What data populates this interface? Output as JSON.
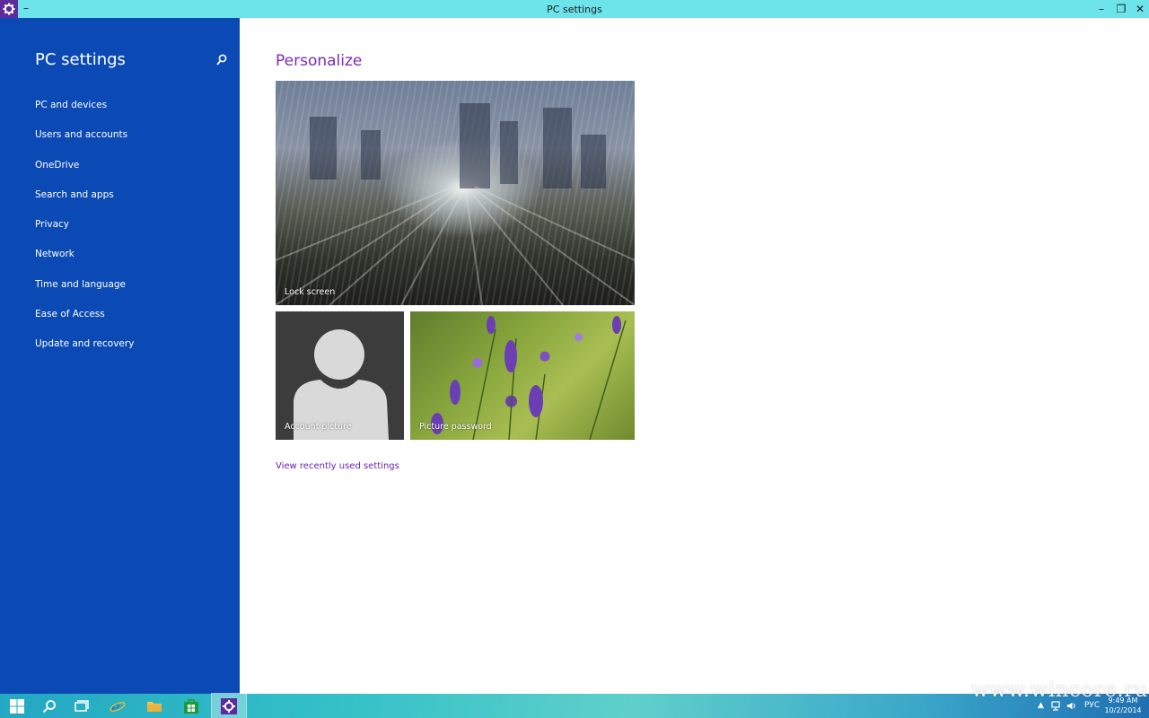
{
  "window": {
    "title": "PC settings",
    "minimize_glyph": "–",
    "restore_glyph": "❐",
    "close_glyph": "✕",
    "app_icon": "gear-icon"
  },
  "sidebar": {
    "heading": "PC settings",
    "search_icon": "search-icon",
    "items": [
      {
        "label": "PC and devices"
      },
      {
        "label": "Users and accounts"
      },
      {
        "label": "OneDrive"
      },
      {
        "label": "Search and apps"
      },
      {
        "label": "Privacy"
      },
      {
        "label": "Network"
      },
      {
        "label": "Time and language"
      },
      {
        "label": "Ease of Access"
      },
      {
        "label": "Update and recovery"
      }
    ]
  },
  "main": {
    "title": "Personalize",
    "tiles": {
      "lock_screen": "Lock screen",
      "account_picture": "Account picture",
      "picture_password": "Picture password"
    },
    "recent_link": "View recently used settings"
  },
  "taskbar": {
    "apps": [
      "start-icon",
      "search-icon",
      "task-view-icon",
      "internet-explorer-icon",
      "file-explorer-icon",
      "store-icon",
      "settings-icon"
    ],
    "tray": {
      "up_arrow": "▲",
      "language": "РУС"
    },
    "clock": {
      "time": "9:49 AM",
      "date": "10/2/2014"
    }
  },
  "watermark": "www.wincore.ru",
  "colors": {
    "sidebar": "#0b4ab5",
    "titlebar": "#6de3ea",
    "accent": "#7a2bb8"
  }
}
